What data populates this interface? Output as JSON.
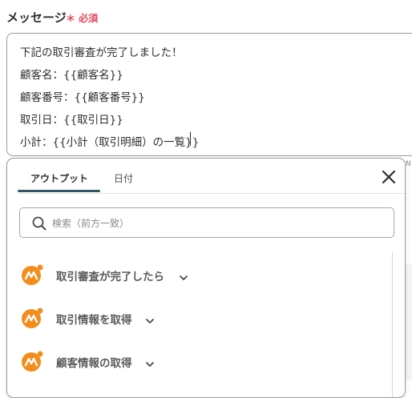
{
  "field": {
    "label": "メッセージ",
    "required": "＊ 必須"
  },
  "message_lines": [
    "下記の取引審査が完了しました！",
    "顧客名：{{顧客名}}",
    "顧客番号：{{顧客番号}}",
    "取引日：{{取引日}}",
    "小計：{{小計（取引明細）の一覧}}"
  ],
  "popup": {
    "tabs": [
      {
        "label": "アウトプット",
        "active": true
      },
      {
        "label": "日付",
        "active": false
      }
    ],
    "search_placeholder": "検索（前方一致）",
    "items": [
      {
        "label": "取引審査が完了したら",
        "icon": "app-logo-icon"
      },
      {
        "label": "取引情報を取得",
        "icon": "app-logo-icon"
      },
      {
        "label": "顧客情報の取得",
        "icon": "app-logo-icon"
      }
    ]
  },
  "side_text": "N",
  "colors": {
    "required": "#e4475d",
    "tab_underline": "#315764",
    "logo_orange": "#f28d1d"
  }
}
